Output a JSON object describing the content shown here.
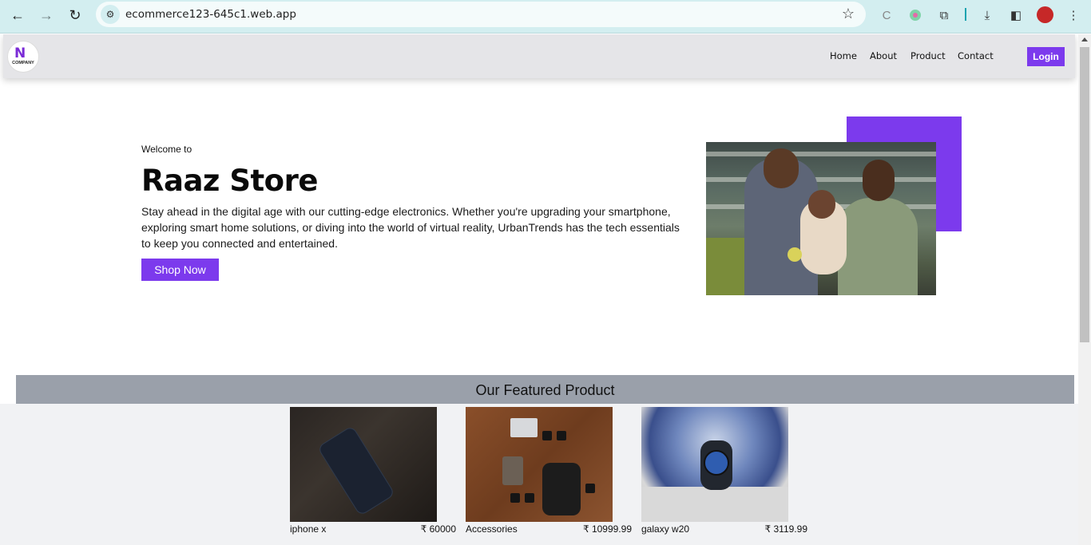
{
  "browser": {
    "url": "ecommerce123-645c1.web.app",
    "icons": [
      "back-arrow-icon",
      "forward-arrow-icon",
      "reload-icon",
      "site-settings-icon",
      "bookmark-star-icon",
      "extension-icon",
      "extension-icon",
      "puzzle-icon",
      "download-icon",
      "sidepanel-icon",
      "profile-avatar",
      "kebab-menu-icon"
    ]
  },
  "site_nav": {
    "logo_word": "COMPANY",
    "links": [
      "Home",
      "About",
      "Product",
      "Contact"
    ],
    "login_label": "Login"
  },
  "hero": {
    "eyebrow": "Welcome to",
    "title": "Raaz Store",
    "description": "Stay ahead in the digital age with our cutting-edge electronics. Whether you're upgrading your smartphone, exploring smart home solutions, or diving into the world of virtual reality, UrbanTrends has the tech essentials to keep you connected and entertained.",
    "cta": "Shop Now"
  },
  "featured": {
    "title": "Our Featured Product",
    "products": [
      {
        "name": "iphone x",
        "price": "₹ 60000"
      },
      {
        "name": "Accessories",
        "price": "₹ 10999.99"
      },
      {
        "name": "galaxy w20",
        "price": "₹ 3119.99"
      }
    ]
  },
  "colors": {
    "accent": "#7c3aed",
    "featured_bar": "#9aa0aa",
    "chrome": "#d3eef0"
  }
}
